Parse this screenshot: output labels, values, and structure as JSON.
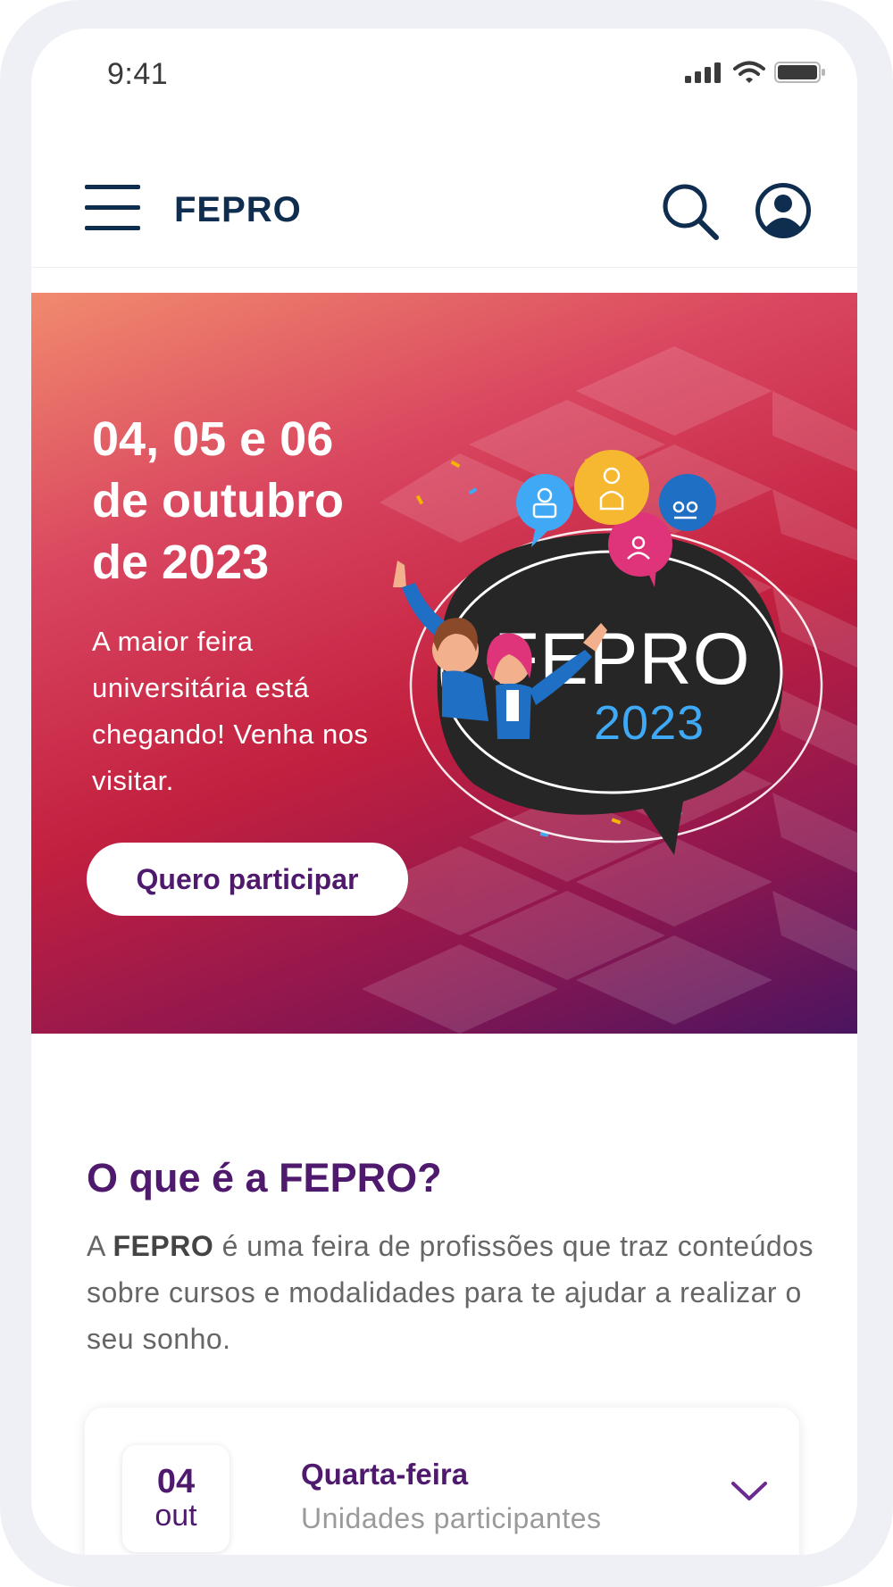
{
  "status_bar": {
    "time": "9:41"
  },
  "header": {
    "brand": "FEPRO"
  },
  "hero": {
    "dates": "04, 05 e 06\nde outubro\nde 2023",
    "description": "A maior feira universitária está chegando! Venha nos visitar.",
    "cta_label": "Quero participar",
    "logo_text": "FEPRO",
    "logo_year": "2023"
  },
  "about": {
    "title": "O que é a FEPRO?",
    "text_prefix": "A ",
    "text_bold": "FEPRO",
    "text_rest": " é uma feira de profissões que traz conteúdos sobre cursos e modalidades para te ajudar a realizar o seu sonho."
  },
  "schedule": [
    {
      "day": "04",
      "month": "out",
      "weekday": "Quarta-feira",
      "subtitle": "Unidades participantes"
    }
  ],
  "colors": {
    "primary_purple": "#4f1a6e",
    "navy": "#0f2d4f",
    "hero_red": "#c2203f",
    "hero_coral": "#f18a6e",
    "logo_blue": "#3fa9f5"
  }
}
